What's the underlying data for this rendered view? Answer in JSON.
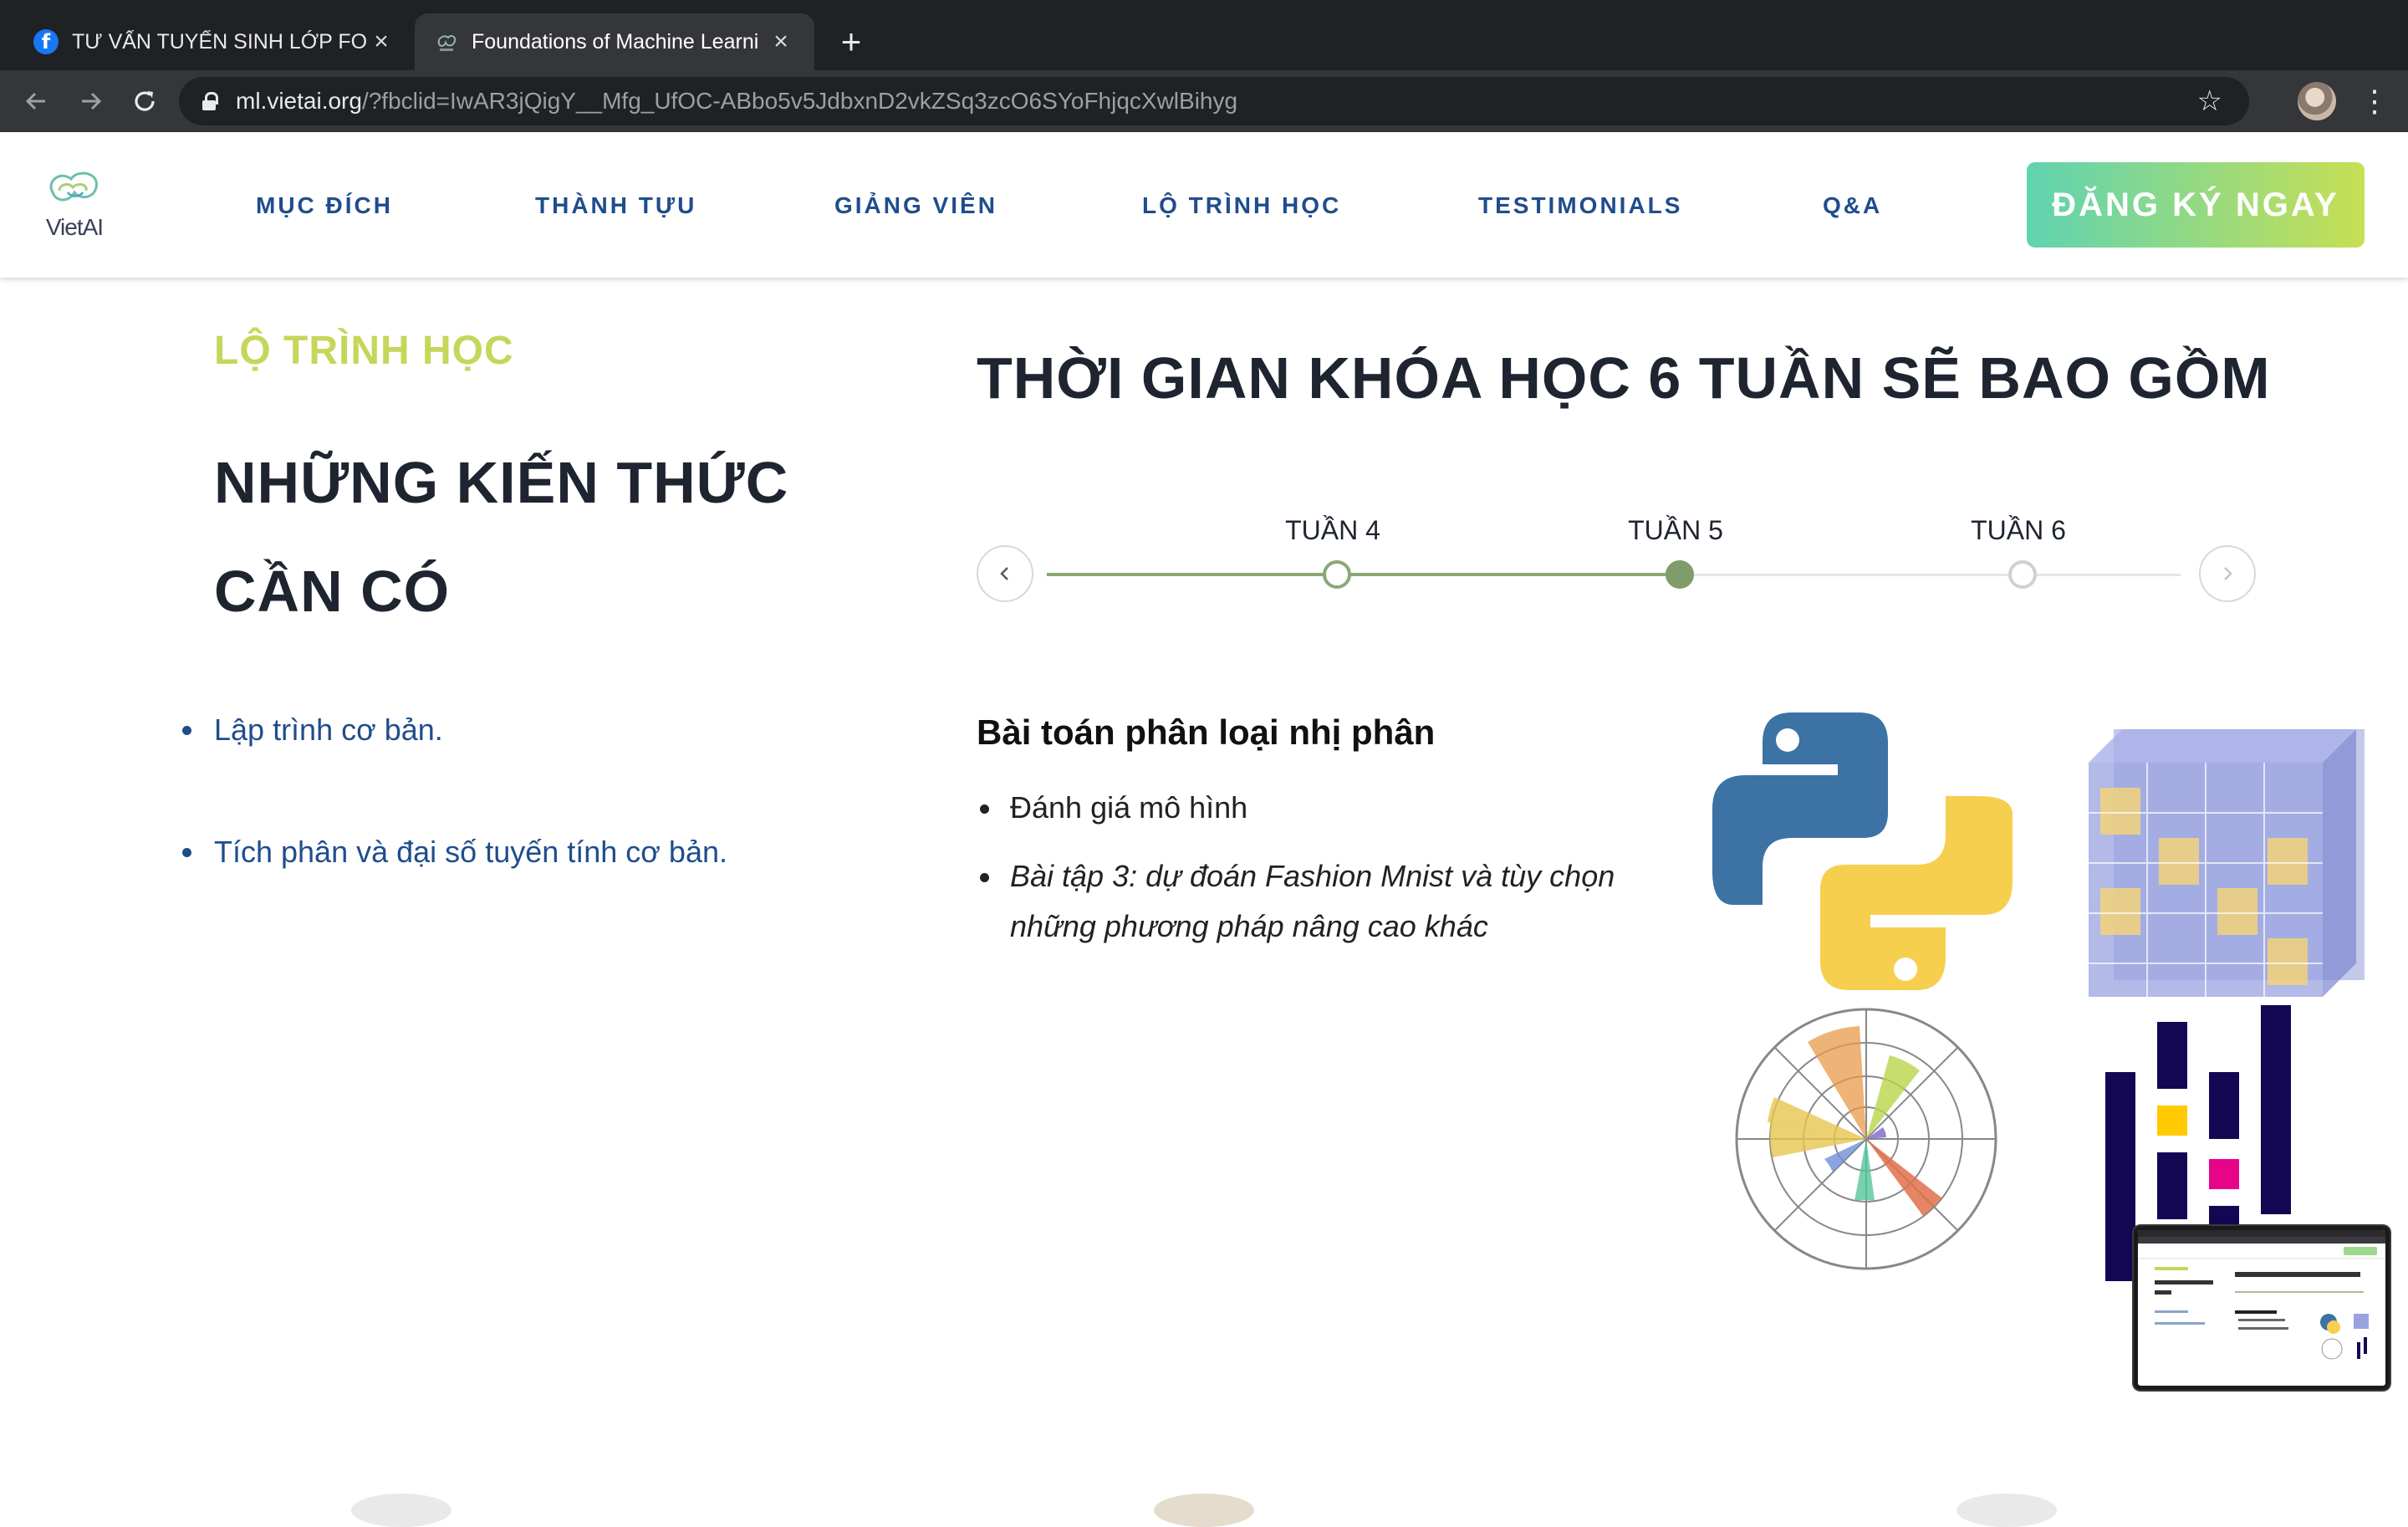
{
  "browser": {
    "tabs": [
      {
        "title": "TƯ VẤN TUYỂN SINH LỚP FOU",
        "icon": "facebook-icon",
        "active": false
      },
      {
        "title": "Foundations of Machine Learni",
        "icon": "vietai-favicon-icon",
        "active": true
      }
    ],
    "url_host": "ml.vietai.org",
    "url_path": "/?fbclid=IwAR3jQigY__Mfg_UfOC-ABbo5v5JdbxnD2vkZSq3zcO6SYoFhjqcXwlBihyg"
  },
  "site": {
    "logo_text": "VietAI",
    "nav": [
      "MỤC ĐÍCH",
      "THÀNH TỰU",
      "GIẢNG VIÊN",
      "LỘ TRÌNH HỌC",
      "TESTIMONIALS",
      "Q&A"
    ],
    "cta": "ĐĂNG KÝ NGAY",
    "brand_colors": {
      "nav_text": "#1f4d8c",
      "accent_label": "#c6d65a",
      "cta_start": "#5fd3b1",
      "cta_end": "#c7df54",
      "timeline": "#8aa876"
    }
  },
  "left": {
    "section_label": "LỘ TRÌNH HỌC",
    "heading": "NHỮNG KIẾN THỨC CẦN CÓ",
    "prerequisites": [
      "Lập trình cơ bản.",
      "Tích phân và đại số tuyến tính cơ bản."
    ]
  },
  "right": {
    "heading": "THỜI GIAN KHÓA HỌC 6 TUẦN SẼ BAO GỒM",
    "timeline": {
      "weeks": [
        "TUẦN 4",
        "TUẦN 5",
        "TUẦN 6"
      ],
      "current": "TUẦN 5",
      "prev_icon": "chevron-left-icon",
      "next_icon": "chevron-right-icon"
    },
    "lesson": {
      "title": "Bài toán phân loại nhị phân",
      "items": [
        {
          "text": "Đánh giá mô hình",
          "italic": false
        },
        {
          "text": "Bài tập 3: dự đoán Fashion Mnist và tùy chọn những phương pháp nâng cao khác",
          "italic": true
        }
      ],
      "images": [
        "python-logo-icon",
        "tensor-cube-icon",
        "polar-bar-chart-icon",
        "pandas-logo-icon"
      ]
    }
  }
}
